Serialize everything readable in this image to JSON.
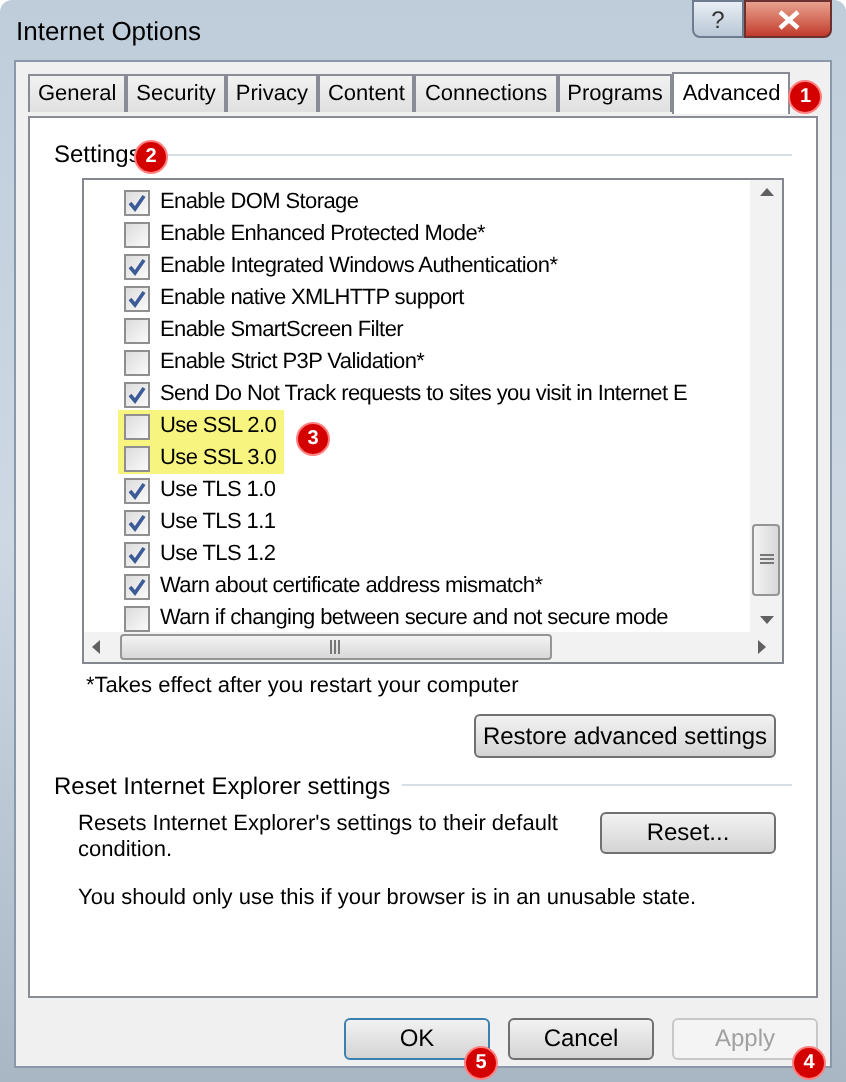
{
  "window": {
    "title": "Internet Options",
    "help": "?"
  },
  "tabs": [
    {
      "label": "General",
      "selected": false
    },
    {
      "label": "Security",
      "selected": false
    },
    {
      "label": "Privacy",
      "selected": false
    },
    {
      "label": "Content",
      "selected": false
    },
    {
      "label": "Connections",
      "selected": false
    },
    {
      "label": "Programs",
      "selected": false
    },
    {
      "label": "Advanced",
      "selected": true,
      "callout": "1"
    }
  ],
  "settings": {
    "title": "Settings",
    "callout": "2",
    "items": [
      {
        "label": "Enable DOM Storage",
        "checked": true,
        "highlighted": false
      },
      {
        "label": "Enable Enhanced Protected Mode*",
        "checked": false,
        "highlighted": false
      },
      {
        "label": "Enable Integrated Windows Authentication*",
        "checked": true,
        "highlighted": false
      },
      {
        "label": "Enable native XMLHTTP support",
        "checked": true,
        "highlighted": false
      },
      {
        "label": "Enable SmartScreen Filter",
        "checked": false,
        "highlighted": false
      },
      {
        "label": "Enable Strict P3P Validation*",
        "checked": false,
        "highlighted": false
      },
      {
        "label": "Send Do Not Track requests to sites you visit in Internet E",
        "checked": true,
        "highlighted": false
      },
      {
        "label": "Use SSL 2.0",
        "checked": false,
        "highlighted": true,
        "callout": "3"
      },
      {
        "label": "Use SSL 3.0",
        "checked": false,
        "highlighted": true
      },
      {
        "label": "Use TLS 1.0",
        "checked": true,
        "highlighted": false
      },
      {
        "label": "Use TLS 1.1",
        "checked": true,
        "highlighted": false
      },
      {
        "label": "Use TLS 1.2",
        "checked": true,
        "highlighted": false
      },
      {
        "label": "Warn about certificate address mismatch*",
        "checked": true,
        "highlighted": false
      },
      {
        "label": "Warn if changing between secure and not secure mode",
        "checked": false,
        "highlighted": false
      }
    ],
    "footnote": "*Takes effect after you restart your computer",
    "restore_button": "Restore advanced settings"
  },
  "reset": {
    "title": "Reset Internet Explorer settings",
    "description": "Resets Internet Explorer's settings to their default condition.",
    "button": "Reset...",
    "note": "You should only use this if your browser is in an unusable state."
  },
  "buttons": [
    {
      "label": "OK",
      "disabled": false,
      "default": true,
      "callout": "5"
    },
    {
      "label": "Cancel",
      "disabled": false,
      "default": false
    },
    {
      "label": "Apply",
      "disabled": true,
      "default": false,
      "callout": "4"
    }
  ]
}
